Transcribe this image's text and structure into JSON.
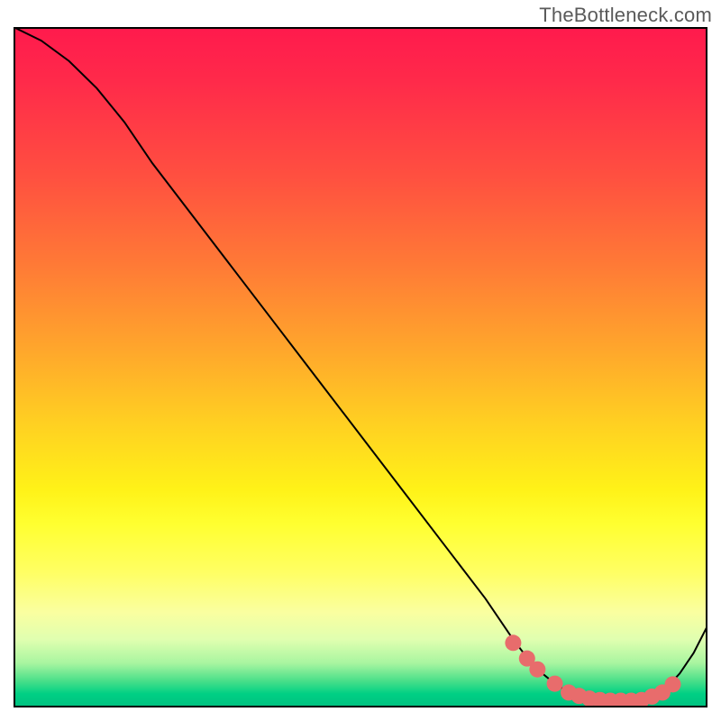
{
  "watermark": "TheBottleneck.com",
  "chart_data": {
    "type": "line",
    "title": "",
    "xlabel": "",
    "ylabel": "",
    "xlim": [
      0,
      100
    ],
    "ylim": [
      0,
      100
    ],
    "x": [
      0,
      4,
      8,
      12,
      16,
      20,
      26,
      32,
      38,
      44,
      50,
      56,
      62,
      68,
      72,
      75,
      78,
      80,
      82,
      84,
      86,
      88,
      90,
      92,
      94,
      96,
      98,
      100
    ],
    "values": [
      100,
      98,
      95,
      91,
      86,
      80,
      72,
      64,
      56,
      48,
      40,
      32,
      24,
      16,
      10,
      6,
      3.5,
      2.2,
      1.5,
      1.1,
      1.0,
      1.0,
      1.1,
      1.6,
      2.8,
      5.0,
      8.0,
      12
    ],
    "markers": {
      "x": [
        72,
        74,
        75.5,
        78,
        80,
        81.5,
        83,
        84.5,
        86,
        87.5,
        89,
        90.5,
        92,
        93.5,
        95
      ],
      "values": [
        9.5,
        7.2,
        5.6,
        3.5,
        2.2,
        1.7,
        1.3,
        1.1,
        1.0,
        1.0,
        1.0,
        1.1,
        1.6,
        2.2,
        3.4
      ],
      "color": "#e86c6c",
      "size": 9
    },
    "line_color": "#000000",
    "line_width": 2
  }
}
